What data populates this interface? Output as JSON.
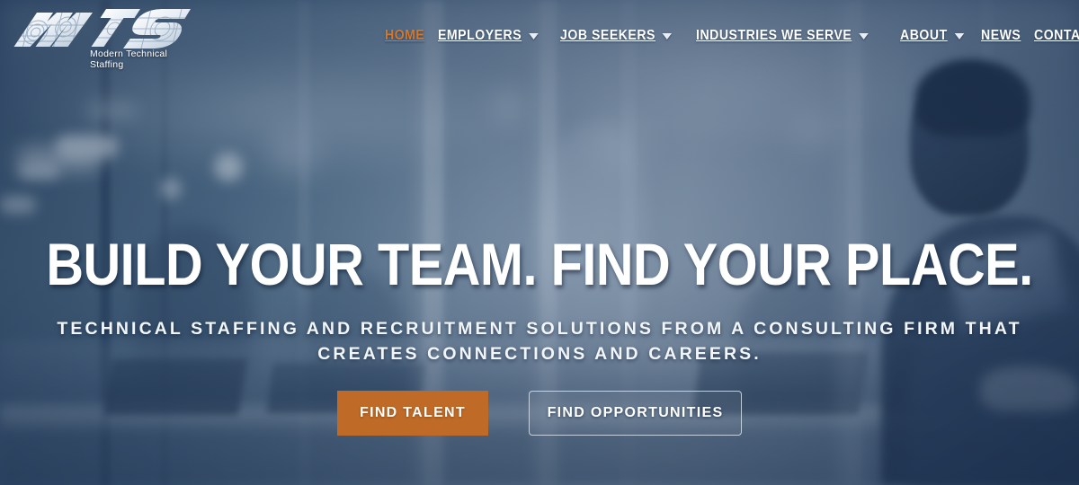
{
  "brand": {
    "logo_mark": "mts",
    "logo_icon": "mts-monogram-logo",
    "tagline": "Modern Technical Staffing"
  },
  "nav": {
    "items": [
      {
        "label": "HOME",
        "active": true,
        "has_dropdown": false,
        "icon": ""
      },
      {
        "label": "EMPLOYERS",
        "active": false,
        "has_dropdown": true,
        "icon": "chevron-down-icon"
      },
      {
        "label": "JOB SEEKERS",
        "active": false,
        "has_dropdown": true,
        "icon": "chevron-down-icon"
      },
      {
        "label": "INDUSTRIES WE SERVE",
        "active": false,
        "has_dropdown": true,
        "icon": "chevron-down-icon"
      },
      {
        "label": "ABOUT",
        "active": false,
        "has_dropdown": true,
        "icon": "chevron-down-icon"
      },
      {
        "label": "NEWS",
        "active": false,
        "has_dropdown": false,
        "icon": ""
      },
      {
        "label": "CONTACT",
        "active": false,
        "has_dropdown": false,
        "icon": ""
      }
    ]
  },
  "hero": {
    "headline": "BUILD YOUR TEAM. FIND YOUR PLACE.",
    "subheadline": "TECHNICAL STAFFING AND RECRUITMENT SOLUTIONS FROM A CONSULTING FIRM THAT CREATES CONNECTIONS AND CAREERS.",
    "primary_cta": "FIND TALENT",
    "secondary_cta": "FIND OPPORTUNITIES"
  },
  "colors": {
    "accent_orange": "#bf6a26",
    "nav_active_orange": "#d4782c",
    "text_white": "#ffffff",
    "background_blue": "#41586f"
  }
}
